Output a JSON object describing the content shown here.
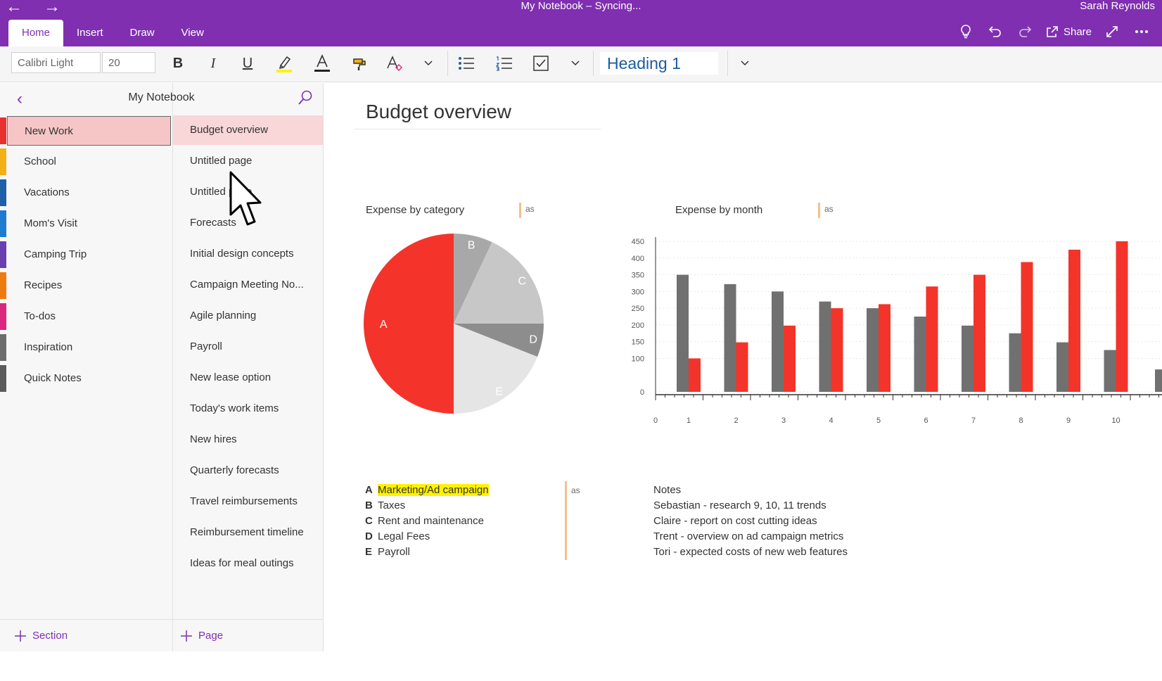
{
  "titlebar": {
    "title": "My Notebook – Syncing...",
    "user": "Sarah Reynolds",
    "tabs": [
      {
        "label": "Home",
        "active": true
      },
      {
        "label": "Insert",
        "active": false
      },
      {
        "label": "Draw",
        "active": false
      },
      {
        "label": "View",
        "active": false
      }
    ],
    "share_label": "Share"
  },
  "ribbon": {
    "font_name": "Calibri Light",
    "font_size": "20",
    "style": "Heading 1"
  },
  "notebook": {
    "title": "My Notebook",
    "sections": [
      {
        "label": "New Work",
        "color": "#e8312f",
        "active": true
      },
      {
        "label": "School",
        "color": "#f2b118"
      },
      {
        "label": "Vacations",
        "color": "#1e5fa8"
      },
      {
        "label": "Mom's Visit",
        "color": "#1e7bd0"
      },
      {
        "label": "Camping Trip",
        "color": "#6a3fb0"
      },
      {
        "label": "Recipes",
        "color": "#f07a12"
      },
      {
        "label": "To-dos",
        "color": "#d9287e"
      },
      {
        "label": "Inspiration",
        "color": "#6d6d6d"
      },
      {
        "label": "Quick Notes",
        "color": "#5b5b5b"
      }
    ],
    "pages": [
      {
        "label": "Budget overview",
        "active": true
      },
      {
        "label": "Untitled page"
      },
      {
        "label": "Untitled page"
      },
      {
        "label": "Forecasts"
      },
      {
        "label": "Initial design concepts"
      },
      {
        "label": "Campaign Meeting No..."
      },
      {
        "label": "Agile planning"
      },
      {
        "label": "Payroll"
      },
      {
        "label": "New lease option"
      },
      {
        "label": "Today's work items"
      },
      {
        "label": "New hires"
      },
      {
        "label": "Quarterly forecasts"
      },
      {
        "label": "Travel reimbursements"
      },
      {
        "label": "Reimbursement timeline"
      },
      {
        "label": "Ideas for meal outings"
      }
    ],
    "add_section": "Section",
    "add_page": "Page"
  },
  "page": {
    "title": "Budget overview",
    "as_tag": "as",
    "legend": [
      {
        "key": "A",
        "text": "Marketing/Ad campaign",
        "highlight": true
      },
      {
        "key": "B",
        "text": "Taxes"
      },
      {
        "key": "C",
        "text": "Rent and maintenance"
      },
      {
        "key": "D",
        "text": "Legal Fees"
      },
      {
        "key": "E",
        "text": "Payroll"
      }
    ],
    "notes": {
      "heading": "Notes",
      "lines": [
        "Sebastian - research 9, 10, 11 trends",
        "Claire - report on cost cutting ideas",
        "Trent - overview on ad campaign metrics",
        "Tori - expected costs of new web features"
      ]
    }
  },
  "chart_data": [
    {
      "type": "pie",
      "title": "Expense by category",
      "labels": [
        "A",
        "B",
        "C",
        "D",
        "E"
      ],
      "values": [
        50,
        7,
        18,
        6,
        19
      ],
      "colors": [
        "#f4342a",
        "#a8a8a8",
        "#c7c7c7",
        "#8d8d8d",
        "#e5e5e5"
      ]
    },
    {
      "type": "bar",
      "title": "Expense by month",
      "categories": [
        "1",
        "2",
        "3",
        "4",
        "5",
        "6",
        "7",
        "8",
        "9",
        "10"
      ],
      "x_ticks": [
        "0",
        "1",
        "2",
        "3",
        "4",
        "5",
        "6",
        "7",
        "8",
        "9",
        "10"
      ],
      "ylim": [
        0,
        450
      ],
      "yticks": [
        0,
        100,
        150,
        200,
        250,
        300,
        350,
        400,
        450
      ],
      "grid": true,
      "series": [
        {
          "color": "#707070",
          "values": [
            350,
            322,
            300,
            270,
            250,
            225,
            198,
            175,
            148,
            125
          ]
        },
        {
          "color": "#f4342a",
          "values": [
            100,
            148,
            198,
            250,
            262,
            315,
            350,
            388,
            425,
            450
          ]
        }
      ]
    }
  ]
}
